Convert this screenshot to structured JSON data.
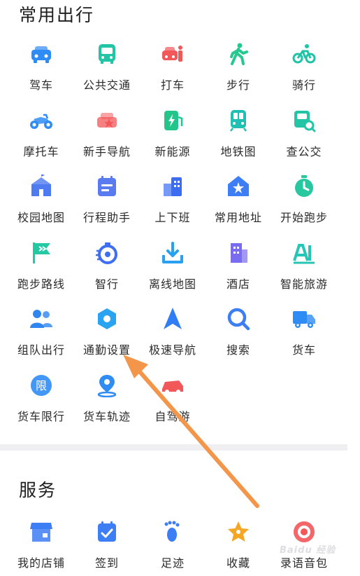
{
  "sections": {
    "travel_title": "常用出行",
    "service_title": "服务"
  },
  "travel_items": [
    {
      "label": "驾车",
      "icon": "car-icon",
      "color": "#2f8cf5"
    },
    {
      "label": "公共交通",
      "icon": "bus-icon",
      "color": "#22c5a6"
    },
    {
      "label": "打车",
      "icon": "taxi-icon",
      "color": "#f2575a"
    },
    {
      "label": "步行",
      "icon": "walk-icon",
      "color": "#27c790"
    },
    {
      "label": "骑行",
      "icon": "bike-icon",
      "color": "#1fc3a6"
    },
    {
      "label": "摩托车",
      "icon": "motorcycle-icon",
      "color": "#2f8cf5"
    },
    {
      "label": "新手导航",
      "icon": "novice-car-icon",
      "color": "#f2575a"
    },
    {
      "label": "新能源",
      "icon": "charging-icon",
      "color": "#22c58a"
    },
    {
      "label": "地铁图",
      "icon": "subway-icon",
      "color": "#1fbfb1"
    },
    {
      "label": "查公交",
      "icon": "bus-search-icon",
      "color": "#22c5a6"
    },
    {
      "label": "校园地图",
      "icon": "campus-icon",
      "color": "#4f7bf0"
    },
    {
      "label": "行程助手",
      "icon": "calendar-icon",
      "color": "#5a7bf0"
    },
    {
      "label": "上下班",
      "icon": "commute-buildings-icon",
      "color": "#3c6df0"
    },
    {
      "label": "常用地址",
      "icon": "home-star-icon",
      "color": "#3e7ef5"
    },
    {
      "label": "开始跑步",
      "icon": "stopwatch-icon",
      "color": "#27c7a0"
    },
    {
      "label": "跑步路线",
      "icon": "flag-icon",
      "color": "#24c9a4"
    },
    {
      "label": "智行",
      "icon": "speed-timer-icon",
      "color": "#3e6ef2"
    },
    {
      "label": "离线地图",
      "icon": "download-icon",
      "color": "#2aa1f0"
    },
    {
      "label": "酒店",
      "icon": "hotel-icon",
      "color": "#7a6cf0"
    },
    {
      "label": "智能旅游",
      "icon": "ai-tour-icon",
      "color": "#26c6b6"
    },
    {
      "label": "组队出行",
      "icon": "team-icon",
      "color": "#2f86f0"
    },
    {
      "label": "通勤设置",
      "icon": "hexagon-gear-icon",
      "color": "#2aa4f0"
    },
    {
      "label": "极速导航",
      "icon": "navigation-arrow-icon",
      "color": "#2f7ef5"
    },
    {
      "label": "搜索",
      "icon": "search-icon",
      "color": "#3e7ef5"
    },
    {
      "label": "货车",
      "icon": "truck-icon",
      "color": "#2f8cf5"
    },
    {
      "label": "货车限行",
      "icon": "restriction-icon",
      "color": "#2f8cf5"
    },
    {
      "label": "货车轨迹",
      "icon": "location-track-icon",
      "color": "#2f8cf5"
    },
    {
      "label": "自驾游",
      "icon": "self-drive-car-icon",
      "color": "#f2575a"
    }
  ],
  "service_items": [
    {
      "label": "我的店铺",
      "icon": "shop-icon",
      "color": "#3e7ef5"
    },
    {
      "label": "签到",
      "icon": "checkin-calendar-icon",
      "color": "#3e7ef5"
    },
    {
      "label": "足迹",
      "icon": "footprint-icon",
      "color": "#3e7ef5"
    },
    {
      "label": "收藏",
      "icon": "star-icon",
      "color": "#f5a623"
    },
    {
      "label": "录语音包",
      "icon": "record-icon",
      "color": "#f2575a"
    }
  ],
  "annotation": {
    "color": "#f4964a"
  },
  "watermark": {
    "text": "Baidu 经验"
  }
}
